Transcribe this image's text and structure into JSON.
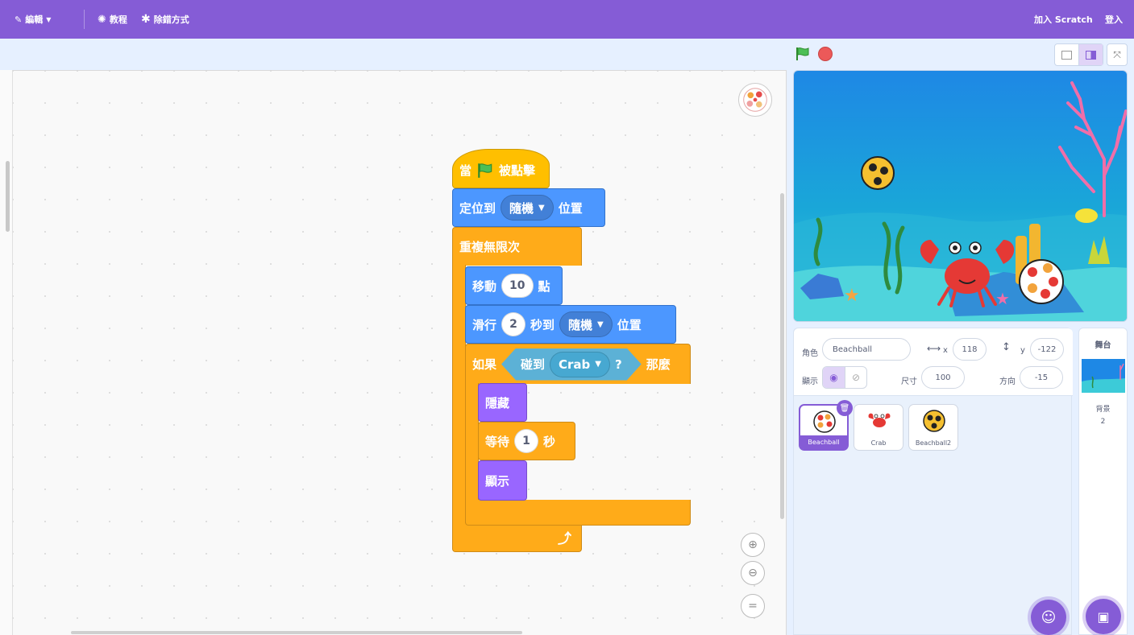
{
  "menu": {
    "edit_label": "編輯",
    "tutorials_label": "教程",
    "debug_label": "除錯方式",
    "join_label": "加入 Scratch",
    "signin_label": "登入"
  },
  "blocks": {
    "when_flag_pre": "當",
    "when_flag_post": "被點擊",
    "goto_label": "定位到",
    "goto_target": "隨機",
    "goto_suffix": "位置",
    "forever_label": "重複無限次",
    "move_label": "移動",
    "move_steps": "10",
    "move_suffix": "點",
    "glide_label": "滑行",
    "glide_secs": "2",
    "glide_mid": "秒到",
    "glide_target": "隨機",
    "glide_suffix": "位置",
    "if_label": "如果",
    "touching_label": "碰到",
    "touching_target": "Crab",
    "touching_q": "?",
    "then_label": "那麼",
    "hide_label": "隱藏",
    "wait_label": "等待",
    "wait_secs": "1",
    "wait_suffix": "秒",
    "show_label": "顯示"
  },
  "sprite_info": {
    "sprite_label": "角色",
    "sprite_name": "Beachball",
    "x_label": "x",
    "x_value": "118",
    "y_label": "y",
    "y_value": "-122",
    "show_label": "顯示",
    "size_label": "尺寸",
    "size_value": "100",
    "direction_label": "方向",
    "direction_value": "-15"
  },
  "sprites": [
    {
      "name": "Beachball",
      "selected": true
    },
    {
      "name": "Crab",
      "selected": false
    },
    {
      "name": "Beachball2",
      "selected": false
    }
  ],
  "stage_panel": {
    "title": "舞台",
    "backdrops_label": "背景",
    "backdrops_count": "2"
  },
  "colors": {
    "accent": "#855cd6",
    "motion": "#4c97ff",
    "control": "#ffab19",
    "events": "#ffbf00",
    "looks": "#9966ff",
    "sensing": "#5cb1d6"
  }
}
